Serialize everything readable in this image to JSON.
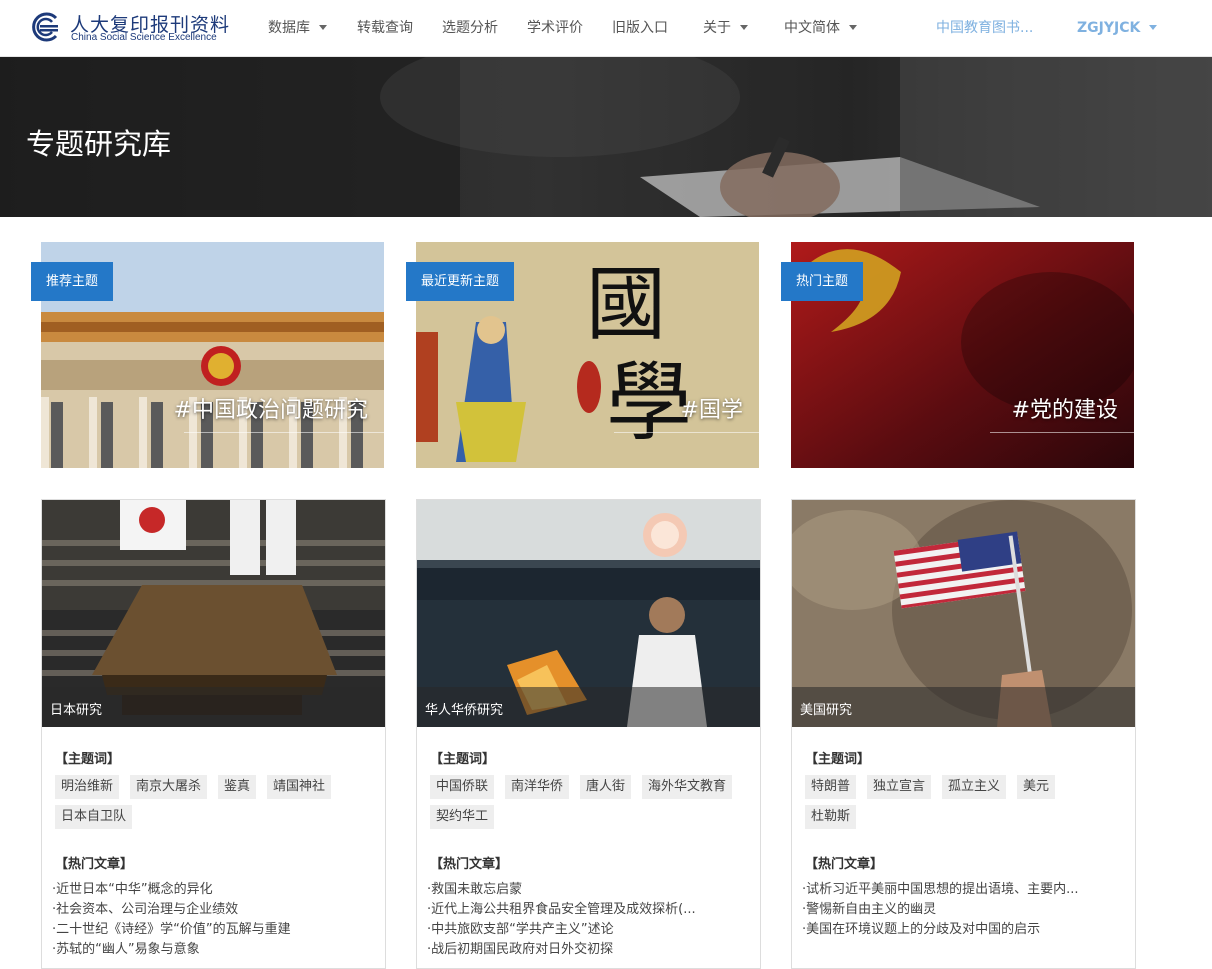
{
  "logo": {
    "cn": "人大复印报刊资料",
    "en": "China Social Science Excellence"
  },
  "nav": {
    "items": [
      {
        "label": "数据库",
        "dropdown": true
      },
      {
        "label": "转载查询",
        "dropdown": false
      },
      {
        "label": "选题分析",
        "dropdown": false
      },
      {
        "label": "学术评价",
        "dropdown": false
      },
      {
        "label": "旧版入口",
        "dropdown": false
      },
      {
        "label": "关于",
        "dropdown": true
      },
      {
        "label": "中文简体",
        "dropdown": true
      }
    ],
    "institution": "中国教育图书...",
    "user": "ZGJYJCK"
  },
  "banner": {
    "title": "专题研究库"
  },
  "features": [
    {
      "tag": "推荐主题",
      "caption": "#中国政治问题研究"
    },
    {
      "tag": "最近更新主题",
      "caption": "#国学"
    },
    {
      "tag": "热门主题",
      "caption": "#党的建设"
    }
  ],
  "topics": [
    {
      "name": "日本研究",
      "keywords_label": "【主题词】",
      "keywords": [
        "明治维新",
        "南京大屠杀",
        "鉴真",
        "靖国神社",
        "日本自卫队"
      ],
      "articles_label": "【热门文章】",
      "articles": [
        "·近世日本“中华”概念的异化",
        "·社会资本、公司治理与企业绩效",
        "·二十世纪《诗经》学“价值”的瓦解与重建",
        "·苏轼的“幽人”易象与意象"
      ]
    },
    {
      "name": "华人华侨研究",
      "keywords_label": "【主题词】",
      "keywords": [
        "中国侨联",
        "南洋华侨",
        "唐人街",
        "海外华文教育",
        "契约华工"
      ],
      "articles_label": "【热门文章】",
      "articles": [
        "·救国未敢忘启蒙",
        "·近代上海公共租界食品安全管理及成效探析(...",
        "·中共旅欧支部“学共产主义”述论",
        "·战后初期国民政府对日外交初探"
      ]
    },
    {
      "name": "美国研究",
      "keywords_label": "【主题词】",
      "keywords": [
        "特朗普",
        "独立宣言",
        "孤立主义",
        "美元",
        "杜勒斯"
      ],
      "articles_label": "【热门文章】",
      "articles": [
        "·试析习近平美丽中国思想的提出语境、主要内...",
        "·警惕新自由主义的幽灵",
        "·美国在环境议题上的分歧及对中国的启示"
      ]
    }
  ],
  "colors": {
    "accent": "#2478c8",
    "brand": "#1d3a7a",
    "user": "#7fb1e0"
  }
}
